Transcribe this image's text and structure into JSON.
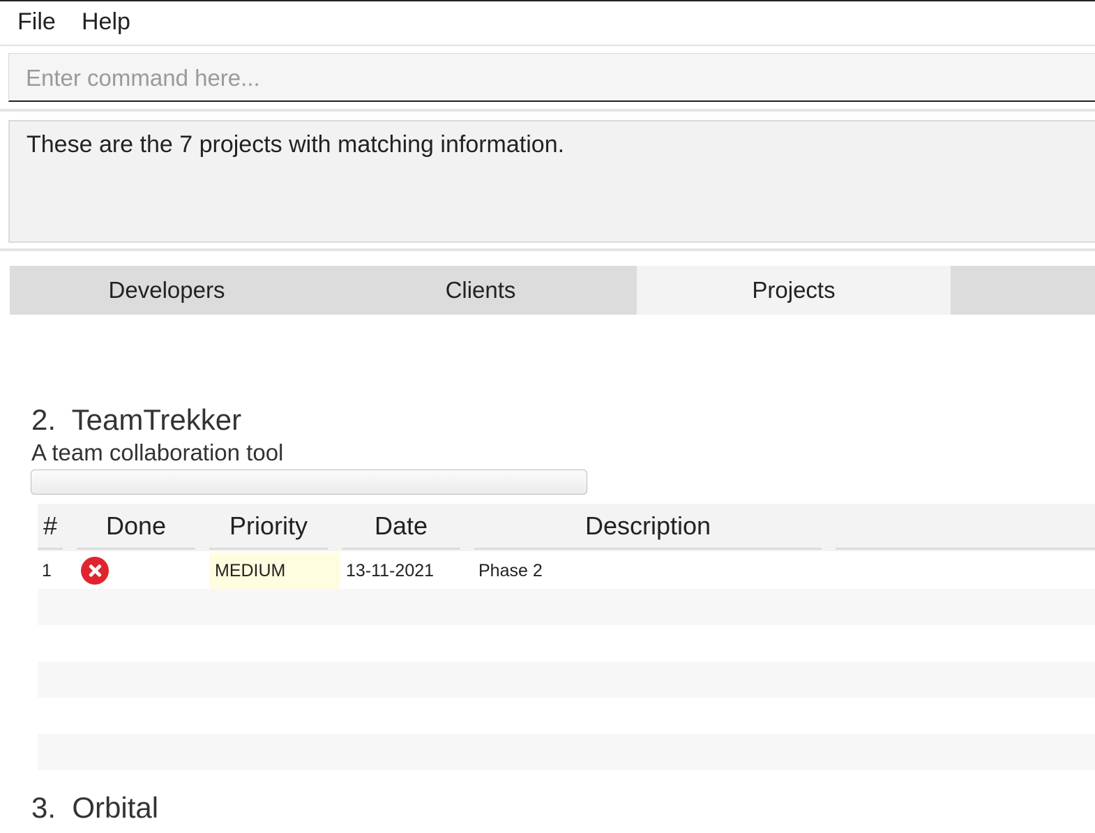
{
  "menu": {
    "file": "File",
    "help": "Help"
  },
  "command": {
    "placeholder": "Enter command here...",
    "value": ""
  },
  "result": {
    "message": "These are the 7 projects with matching information."
  },
  "tabs": [
    {
      "label": "Developers",
      "selected": false
    },
    {
      "label": "Clients",
      "selected": false
    },
    {
      "label": "Projects",
      "selected": true
    }
  ],
  "projects": [
    {
      "index": "2.",
      "name": "TeamTrekker",
      "description": "A team collaboration tool",
      "progress": 0,
      "table": {
        "headers": [
          "#",
          "Done",
          "Priority",
          "Date",
          "Description"
        ],
        "rows": [
          {
            "num": "1",
            "done": "x-icon",
            "priority": "MEDIUM",
            "date": "13-11-2021",
            "description": "Phase 2"
          }
        ]
      }
    },
    {
      "index": "3.",
      "name": "Orbital"
    }
  ],
  "colors": {
    "not_done_icon": "#e0242e",
    "priority_medium_bg": "#fffde0",
    "selected_tab_bg": "#f3f3f3",
    "tab_bg": "#dcdcdc"
  }
}
